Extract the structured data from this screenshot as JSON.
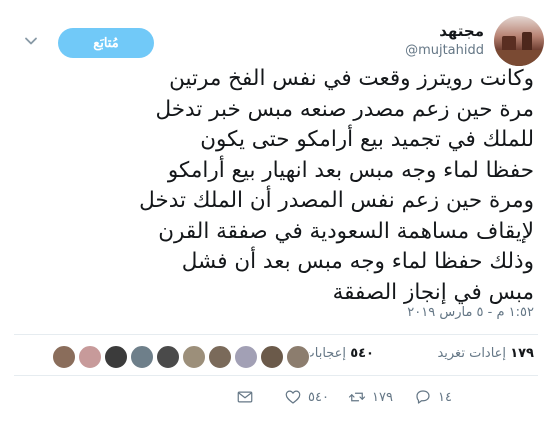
{
  "header": {
    "display_name": "مجتهد",
    "handle": "@mujtahidd",
    "follow_label": "مُتابَع"
  },
  "tweet": {
    "lines": [
      "وكانت رويترز وقعت في نفس الفخ مرتين",
      "مرة حين زعم مصدر صنعه مبس خبر تدخل",
      "للملك في تجميد بيع أرامكو حتى يكون",
      "حفظا لماء وجه مبس بعد انهيار بيع أرامكو",
      "ومرة حين زعم نفس المصدر أن الملك تدخل",
      "لإيقاف مساهمة السعودية في صفقة القرن",
      "وذلك حفظا لماء وجه مبس بعد أن فشل",
      "مبس في إنجاز الصفقة"
    ],
    "timestamp": "١:٥٢ م - ٥ مارس ٢٠١٩"
  },
  "stats": {
    "retweets_count": "١٧٩",
    "retweets_label": "إعادات تغريد",
    "likes_count": "٥٤٠",
    "likes_label": "إعجابات",
    "liker_colors": [
      "#8a6d5b",
      "#c79a9a",
      "#3b3b3b",
      "#6e7f8a",
      "#4a4a4a",
      "#9c8f7a",
      "#7a6a5a",
      "#a2a0b5",
      "#6b5a4a",
      "#8c7d6e"
    ]
  },
  "actions": {
    "reply_count": "١٤",
    "retweet_count": "١٧٩",
    "like_count": "٥٤٠"
  }
}
